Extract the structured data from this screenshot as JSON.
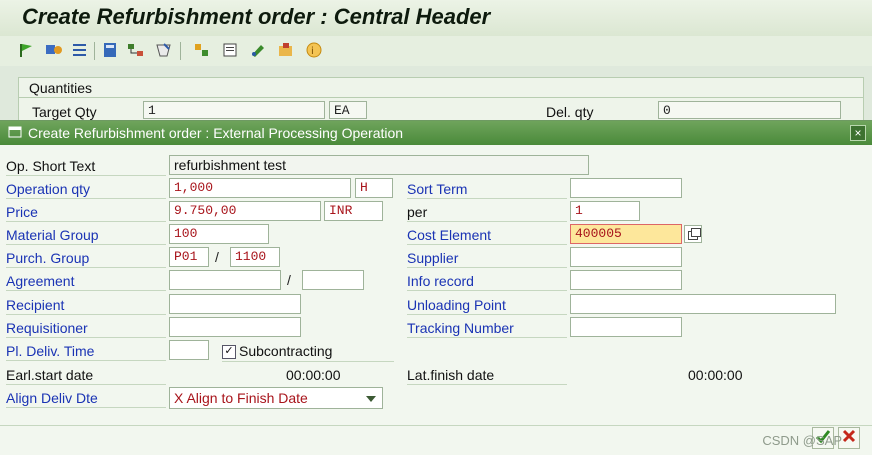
{
  "window": {
    "title": "Create Refurbishment order : Central Header"
  },
  "toolbar": {
    "icons": [
      "flag-icon",
      "settings-icon",
      "list-icon",
      "calculator-icon",
      "hierarchy-icon",
      "edit-icon",
      "components-icon",
      "document-icon",
      "pencil-icon",
      "attachment-icon",
      "info-icon"
    ]
  },
  "quantities": {
    "section_title": "Quantities",
    "target_qty_label": "Target Qty",
    "target_qty_value": "1",
    "target_qty_unit": "EA",
    "del_qty_label": "Del. qty",
    "del_qty_value": "0"
  },
  "dialog": {
    "title": "Create Refurbishment order : External Processing Operation",
    "close_label": "×",
    "left": {
      "op_short_text_label": "Op. Short Text",
      "op_short_text_value": "refurbishment test",
      "operation_qty_label": "Operation qty",
      "operation_qty_value": "1,000",
      "operation_qty_unit": "H",
      "price_label": "Price",
      "price_value": "9.750,00",
      "price_currency": "INR",
      "material_group_label": "Material Group",
      "material_group_value": "100",
      "purch_group_label": "Purch. Group",
      "purch_group_value": "P01",
      "purch_org_value": "1100",
      "agreement_label": "Agreement",
      "agreement_value": "",
      "agreement_item_value": "",
      "recipient_label": "Recipient",
      "recipient_value": "",
      "requisitioner_label": "Requisitioner",
      "requisitioner_value": "",
      "pl_deliv_time_label": "Pl. Deliv. Time",
      "pl_deliv_time_value": "",
      "subcontracting_label": "Subcontracting",
      "subcontracting_checked": "✓",
      "earl_start_label": "Earl.start date",
      "earl_start_time": "00:00:00",
      "align_label": "Align Deliv Dte",
      "align_value": "X Align to Finish Date"
    },
    "right": {
      "sort_term_label": "Sort Term",
      "sort_term_value": "",
      "per_label": "per",
      "per_value": "1",
      "cost_element_label": "Cost Element",
      "cost_element_value": "400005",
      "supplier_label": "Supplier",
      "supplier_value": "",
      "info_record_label": "Info record",
      "info_record_value": "",
      "unloading_point_label": "Unloading Point",
      "unloading_point_value": "",
      "tracking_number_label": "Tracking Number",
      "tracking_number_value": "",
      "lat_finish_label": "Lat.finish date",
      "lat_finish_time": "00:00:00"
    },
    "separator": "/",
    "footer_buttons": [
      "confirm-icon",
      "cancel-icon"
    ]
  },
  "watermark": "CSDN @SAP"
}
